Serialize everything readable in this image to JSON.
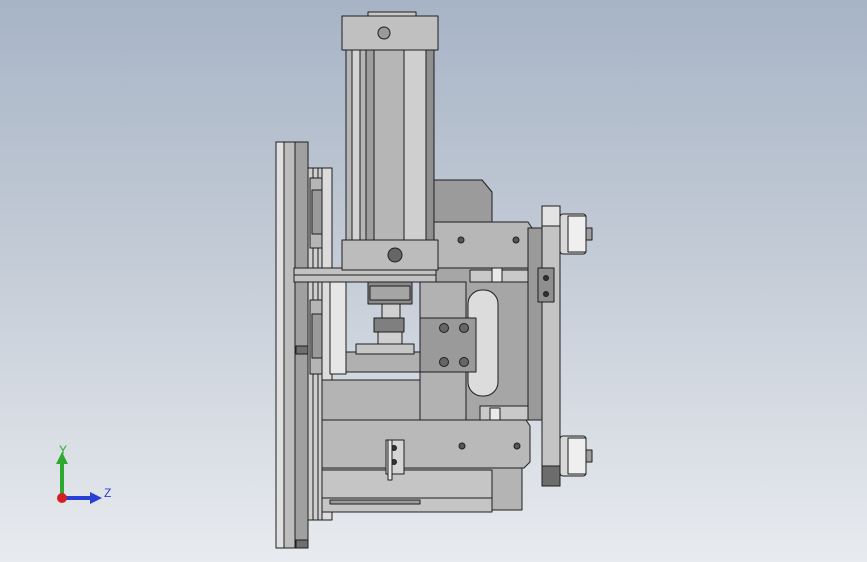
{
  "triad": {
    "y_label": "Y",
    "z_label": "Z",
    "colors": {
      "y": "#2fa82f",
      "z": "#2a3fd6",
      "origin": "#d42020"
    }
  },
  "palette": {
    "bg_top": "#a7b4c6",
    "bg_bottom": "#e8ebef",
    "part_light": "#c8c8c8",
    "part_mid": "#a9a9a9",
    "part_dark": "#7a7a7a",
    "edge": "#1e1e1e"
  }
}
